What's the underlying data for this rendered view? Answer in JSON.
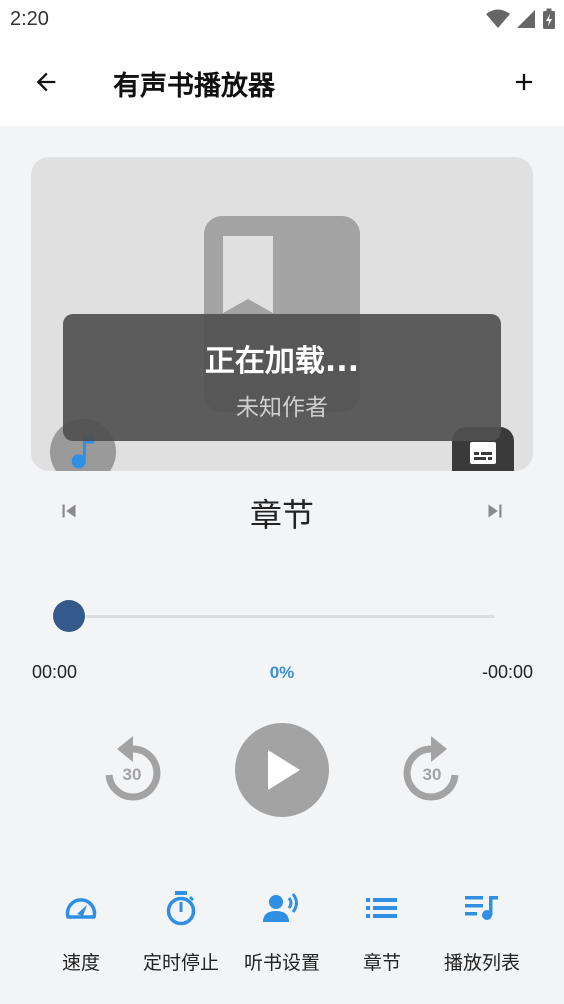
{
  "status": {
    "time": "2:20"
  },
  "appbar": {
    "title": "有声书播放器"
  },
  "book": {
    "title": "正在加载...",
    "author": "未知作者"
  },
  "chapter": {
    "title": "章节"
  },
  "progress": {
    "elapsed": "00:00",
    "percent_label": "0%",
    "remaining": "-00:00",
    "fraction": 0
  },
  "controls": {
    "rewind_seconds": "30",
    "forward_seconds": "30"
  },
  "bottom_nav": [
    {
      "label": "速度",
      "icon": "speedometer-icon"
    },
    {
      "label": "定时停止",
      "icon": "timer-icon"
    },
    {
      "label": "听书设置",
      "icon": "voice-settings-icon"
    },
    {
      "label": "章节",
      "icon": "list-icon"
    },
    {
      "label": "播放列表",
      "icon": "playlist-icon"
    }
  ],
  "colors": {
    "accent": "#2f8fe3",
    "thumb": "#34598a",
    "disabled_gray": "#a3a3a3"
  }
}
